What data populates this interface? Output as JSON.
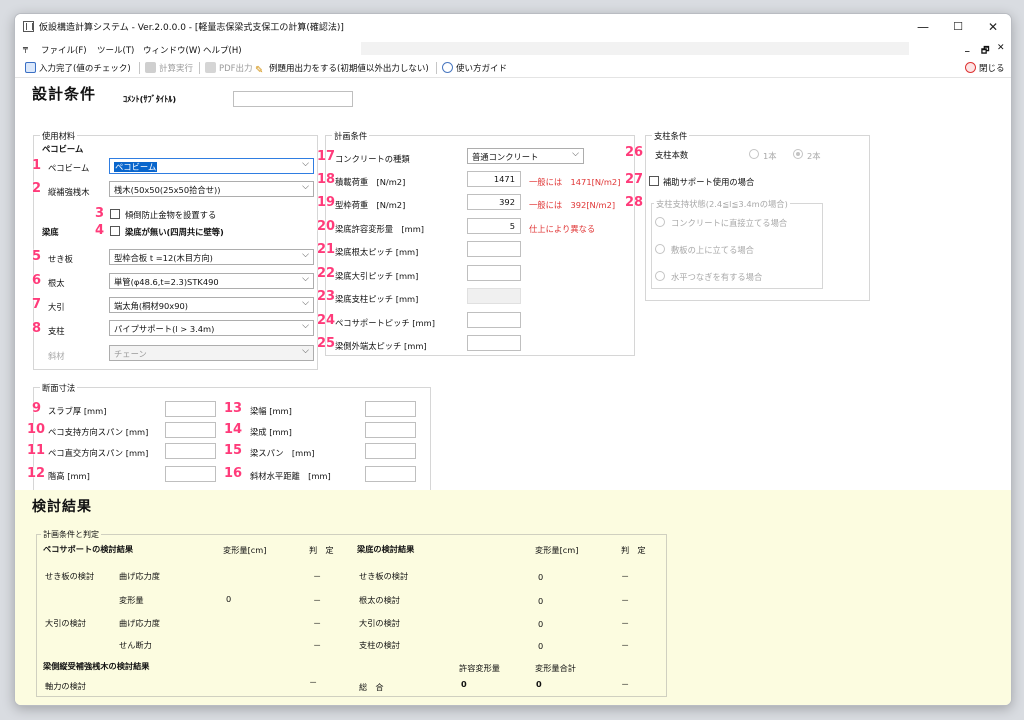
{
  "window": {
    "title": "仮設構造計算システム - Ver.2.0.0.0 - [軽量志保梁式支保工の計算(確認法)]",
    "minimize": "—",
    "maximize": "☐",
    "close": "✕"
  },
  "menu": {
    "items": [
      "ファイル(F)",
      "ツール(T)",
      "ウィンドウ(W)",
      "ヘルプ(H)"
    ],
    "mdi_min": "_",
    "mdi_restore": "🗗",
    "mdi_close": "✕"
  },
  "toolbar": {
    "input_done": "入力完了(値のチェック)",
    "calc": "計算実行",
    "pdf": "PDF出力",
    "example": "例題用出力をする(初期値以外出力しない)",
    "guide": "使い方ガイド",
    "close": "閉じる"
  },
  "form": {
    "title": "設計条件",
    "comment_label": "ｺﾒﾝﾄ(ｻﾌﾞﾀｲﾄﾙ)",
    "comment_value": "",
    "materials": {
      "group": "使用材料",
      "sub_beam": "ペコビーム",
      "beam_label": "ペコビーム",
      "beam_value": "ペコビーム",
      "rein_label": "縦補強桟木",
      "rein_value": "桟木(50x50(25x50拾合せ))",
      "tilt_label": "傾倒防止金物を設置する",
      "bottom_label": "梁底",
      "nofloor_label": "梁底が無い(四周共に壁等)",
      "seki_label": "せき板",
      "seki_value": "型枠合板 t =12(木目方向)",
      "neda_label": "根太",
      "neda_value": "単管(φ48.6,t=2.3)STK490",
      "obiki_label": "大引",
      "obiki_value": "端太角(桐材90x90)",
      "shichu_label": "支柱",
      "shichu_value": "パイプサポート(l > 3.4m)",
      "shazai_label": "斜材",
      "shazai_value": "チェーン"
    },
    "plan": {
      "group": "計画条件",
      "concrete_label": "コンクリートの種類",
      "concrete_value": "普通コンクリート",
      "load_label": "積載荷重　[N/m2]",
      "load_value": "1471",
      "load_note": "一般には　1471[N/m2]",
      "form_label": "型枠荷重　[N/m2]",
      "form_value": "392",
      "form_note": "一般には　392[N/m2]",
      "defl_label": "梁底許容変形量　[mm]",
      "defl_value": "5",
      "defl_note": "仕上により異なる",
      "neda_pitch": "梁底根太ピッチ [mm]",
      "obiki_pitch": "梁底大引ピッチ [mm]",
      "shichu_pitch": "梁底支柱ピッチ [mm]",
      "peco_pitch": "ペコサポートピッチ [mm]",
      "side_pitch": "梁側外端太ピッチ [mm]"
    },
    "support": {
      "group": "支柱条件",
      "count_label": "支柱本数",
      "opt1": "1本",
      "opt2": "2本",
      "aux_label": "補助サポート使用の場合",
      "state_group": "支柱支持状態(2.4≦l≦3.4mの場合)",
      "s1": "コンクリートに直接立てる場合",
      "s2": "敷板の上に立てる場合",
      "s3": "水平つなぎを有する場合"
    },
    "section": {
      "group": "断面寸法",
      "slab": "スラブ厚 [mm]",
      "span1": "ペコ支持方向スパン [mm]",
      "span2": "ペコ直交方向スパン [mm]",
      "height": "階高 [mm]",
      "width": "梁幅 [mm]",
      "depth": "梁成 [mm]",
      "bspan": "梁スパン　[mm]",
      "horiz": "斜材水平距離　[mm]"
    },
    "markers": [
      "1",
      "2",
      "3",
      "4",
      "5",
      "6",
      "7",
      "8",
      "9",
      "10",
      "11",
      "12",
      "13",
      "14",
      "15",
      "16",
      "17",
      "18",
      "19",
      "20",
      "21",
      "22",
      "23",
      "24",
      "25",
      "26",
      "27",
      "28"
    ]
  },
  "result": {
    "title": "検討結果",
    "group": "計画条件と判定",
    "left_head": "ペコサポートの検討結果",
    "col_defl": "変形量[cm]",
    "col_judge": "判　定",
    "right_head": "梁底の検討結果",
    "rows_left": [
      {
        "a": "せき板の検討",
        "b": "曲げ応力度",
        "c": "",
        "d": "－"
      },
      {
        "a": "",
        "b": "変形量",
        "c": "0",
        "d": "－"
      },
      {
        "a": "大引の検討",
        "b": "曲げ応力度",
        "c": "",
        "d": "－"
      },
      {
        "a": "",
        "b": "せん断力",
        "c": "",
        "d": "－"
      }
    ],
    "rows_right": [
      {
        "a": "せき板の検討",
        "c": "0",
        "d": "－"
      },
      {
        "a": "根太の検討",
        "c": "0",
        "d": "－"
      },
      {
        "a": "大引の検討",
        "c": "0",
        "d": "－"
      },
      {
        "a": "支柱の検討",
        "c": "0",
        "d": "－"
      }
    ],
    "side_head": "梁側縦受補強桟木の検討結果",
    "axial": "軸力の検討",
    "axial_judge": "－",
    "allow_head": "許容変形量",
    "total_head": "変形量合計",
    "total_label": "総　合",
    "allow_val": "0",
    "total_val": "0",
    "total_judge": "－"
  },
  "colors": {
    "marker": "#ff3b7a",
    "note": "#e03535",
    "result_bg": "#fcfce0",
    "select_highlight": "#0a66cc"
  }
}
